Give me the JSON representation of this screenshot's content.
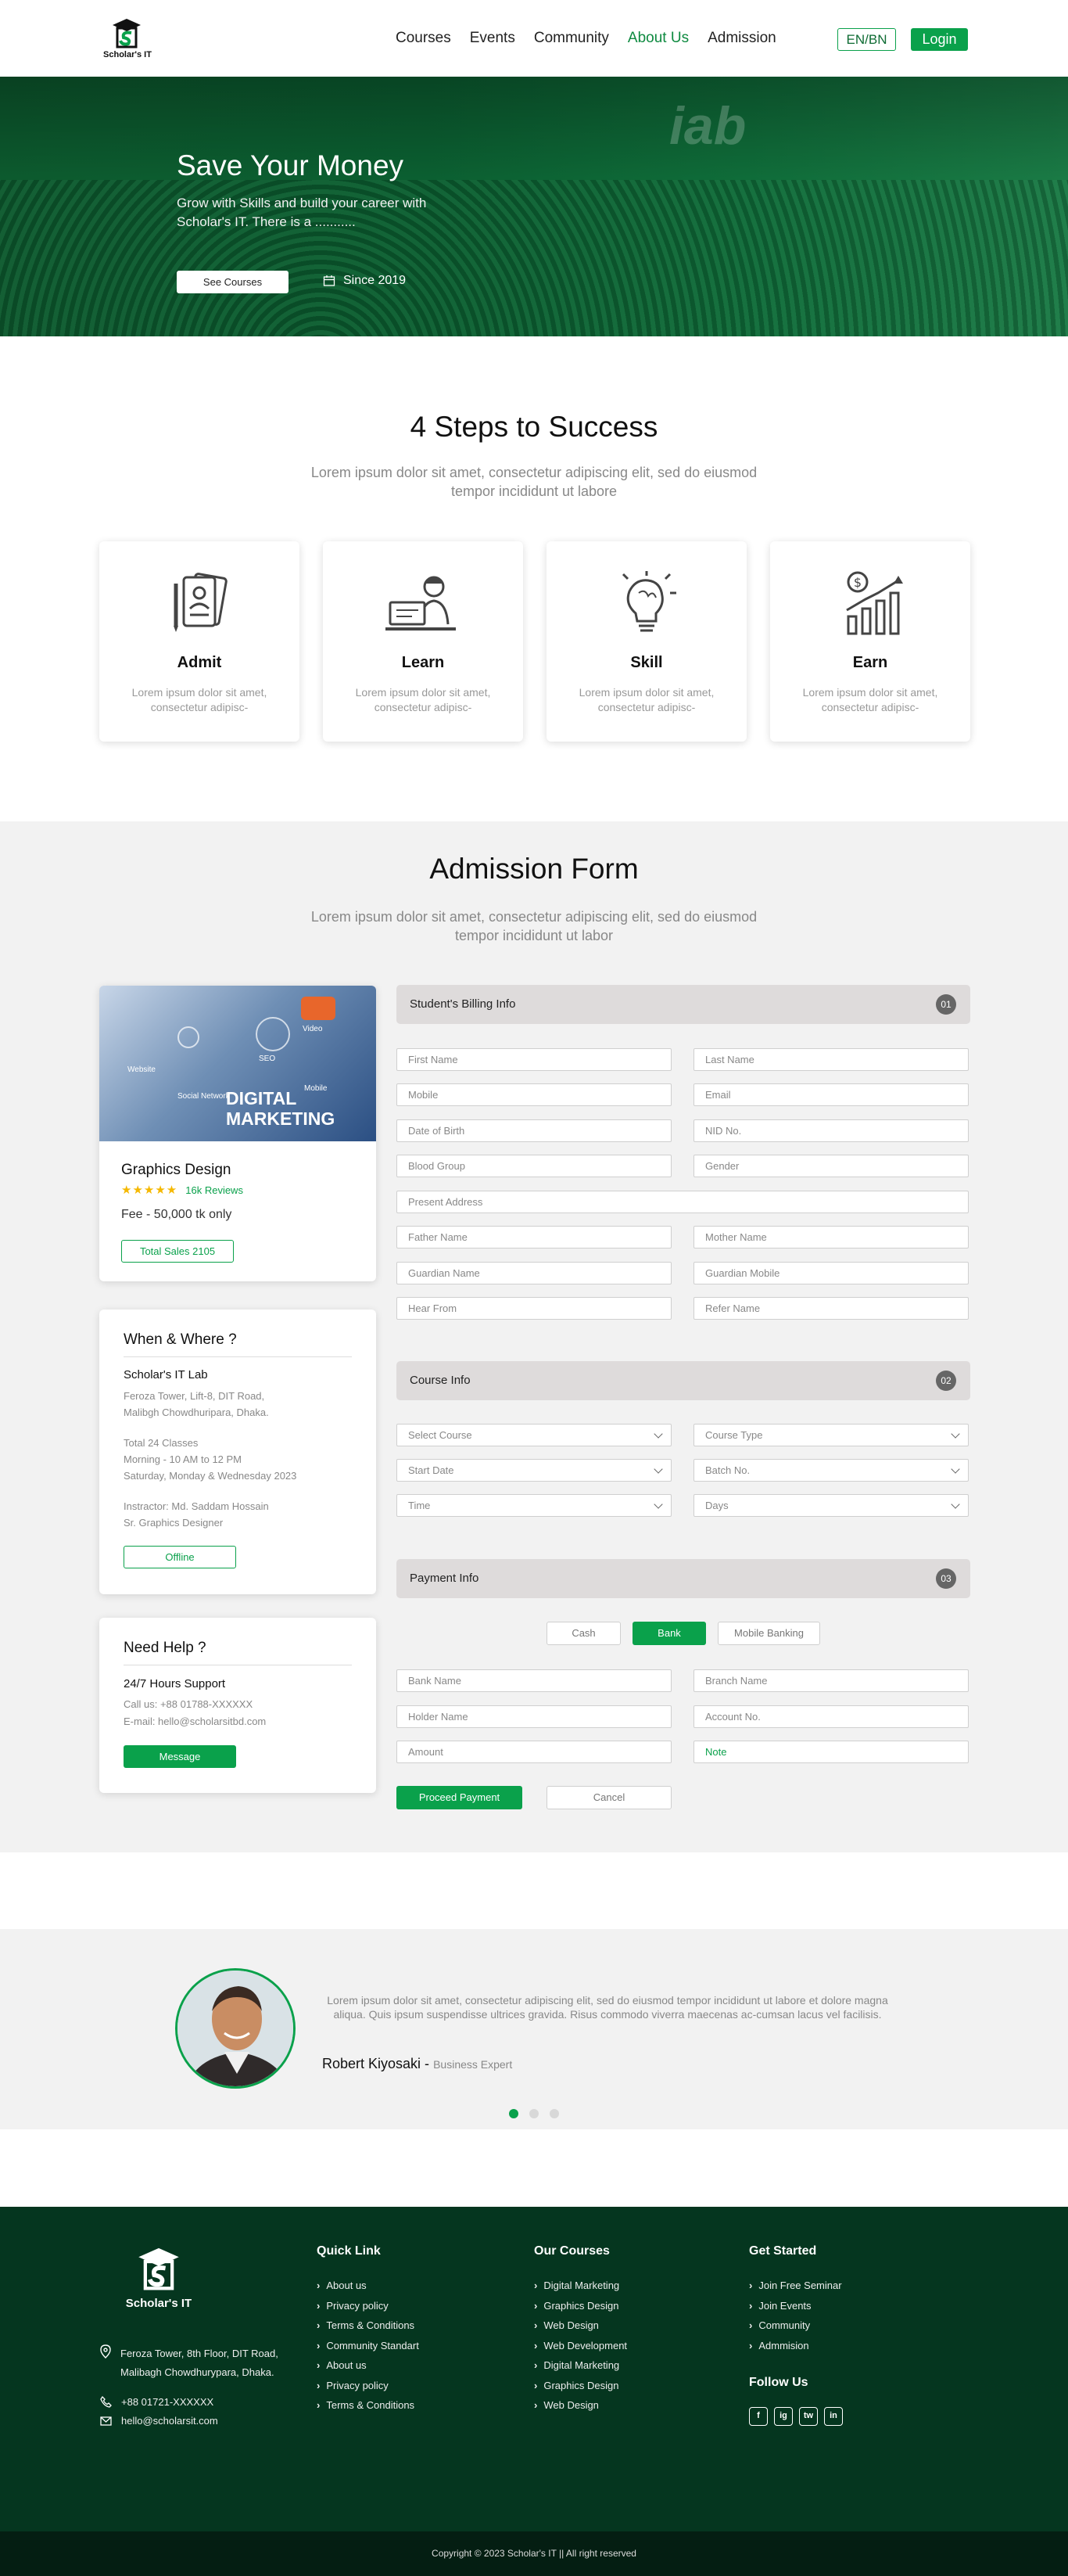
{
  "header": {
    "logo_text": "Scholar's IT",
    "nav": [
      "Courses",
      "Events",
      "Community",
      "About Us",
      "Admission"
    ],
    "active_nav": "About Us",
    "lang": "EN/BN",
    "login": "Login"
  },
  "hero": {
    "title": "Save Your Money",
    "subtitle": "Grow with Skills and build your career with Scholar's IT. There is a ...........",
    "see_courses": "See Courses",
    "since": "Since 2019",
    "stage_text": "iab"
  },
  "steps": {
    "title": "4 Steps to Success",
    "subtitle": "Lorem ipsum dolor sit amet, consectetur adipiscing elit, sed do eiusmod tempor incididunt ut labore",
    "cards": [
      {
        "title": "Admit",
        "desc": "Lorem ipsum dolor sit amet, consectetur adipisc-",
        "icon": "document-icon"
      },
      {
        "title": "Learn",
        "desc": "Lorem ipsum dolor sit amet, consectetur adipisc-",
        "icon": "student-laptop-icon"
      },
      {
        "title": "Skill",
        "desc": "Lorem ipsum dolor sit amet, consectetur adipisc-",
        "icon": "lightbulb-brain-icon"
      },
      {
        "title": "Earn",
        "desc": "Lorem ipsum dolor sit amet, consectetur adipisc-",
        "icon": "growth-chart-icon"
      }
    ]
  },
  "admission": {
    "title": "Admission Form",
    "subtitle": "Lorem ipsum dolor sit amet, consectetur adipiscing elit, sed do eiusmod tempor incididunt ut labor",
    "course_card": {
      "image_labels": [
        "Website",
        "Video",
        "SEO",
        "Mobile",
        "Social Network"
      ],
      "image_caption": "DIGITAL MARKETING",
      "name": "Graphics Design",
      "rating": 4.5,
      "reviews": "16k Reviews",
      "fee": "Fee - 50,000 tk only",
      "sales": "Total Sales 2105"
    },
    "when_card": {
      "title": "When & Where ?",
      "org": "Scholar's IT Lab",
      "address1": "Feroza Tower, Lift-8, DIT Road,",
      "address2": "Malibgh Chowdhuripara, Dhaka.",
      "classes": "Total  24 Classes",
      "time": "Morning - 10 AM to 12 PM",
      "days": "Saturday, Monday & Wednesday 2023",
      "instructor": "Instractor: Md. Saddam Hossain",
      "designation": "Sr. Graphics Designer",
      "mode": "Offline"
    },
    "help_card": {
      "title": "Need Help ?",
      "support": "24/7 Hours Support",
      "call": "Call us: +88 01788-XXXXXX",
      "email": "E-mail: hello@scholarsitbd.com",
      "message_btn": "Message"
    },
    "billing": {
      "title": "Student's Billing Info",
      "num": "01",
      "fields": [
        "First Name",
        "Last Name",
        "Mobile",
        "Email",
        "Date of Birth",
        "NID No.",
        "Blood Group",
        "Gender",
        "Present Address",
        "Father Name",
        "Mother Name",
        "Guardian Name",
        "Guardian Mobile",
        "Hear From",
        "Refer Name"
      ]
    },
    "course_info": {
      "title": "Course Info",
      "num": "02",
      "selects": [
        "Select Course",
        "Course Type",
        "Start Date",
        "Batch No.",
        "Time",
        "Days"
      ]
    },
    "payment": {
      "title": "Payment Info",
      "num": "03",
      "methods": [
        "Cash",
        "Bank",
        "Mobile Banking"
      ],
      "active_method": "Bank",
      "fields": [
        "Bank Name",
        "Branch Name",
        "Holder Name",
        "Account No.",
        "Amount",
        "Note"
      ],
      "proceed": "Proceed Payment",
      "cancel": "Cancel"
    }
  },
  "testimonial": {
    "quote": "Lorem ipsum dolor sit amet, consectetur adipiscing elit, sed do eiusmod tempor incididunt ut labore et dolore magna aliqua. Quis ipsum suspendisse ultrices gravida. Risus commodo viverra maecenas ac-cumsan lacus vel facilisis.",
    "name": "Robert Kiyosaki -",
    "role": "Business Expert",
    "active_dot": 0
  },
  "footer": {
    "logo_text": "Scholar's IT",
    "address1": "Feroza Tower, 8th Floor, DIT Road,",
    "address2": "Malibagh Chowdhurypara, Dhaka.",
    "phone": "+88 01721-XXXXXX",
    "email": "hello@scholarsit.com",
    "quick_title": "Quick Link",
    "quick": [
      "About us",
      "Privacy policy",
      "Terms & Conditions",
      "Community Standart",
      "About us",
      "Privacy policy",
      "Terms & Conditions"
    ],
    "courses_title": "Our Courses",
    "courses": [
      "Digital Marketing",
      "Graphics Design",
      "Web Design",
      "Web Development",
      "Digital Marketing",
      "Graphics Design",
      "Web Design"
    ],
    "started_title": "Get Started",
    "started": [
      "Join Free Seminar",
      "Join Events",
      "Community",
      "Admmision"
    ],
    "follow": "Follow Us",
    "social": [
      "f",
      "ig",
      "tw",
      "in"
    ],
    "copyright": "Copyright © 2023 Scholar's IT || All right reserved"
  },
  "colors": {
    "brand_green": "#0aa14b",
    "hero_green": "#0b5f31",
    "footer_bg": "#05361f"
  }
}
